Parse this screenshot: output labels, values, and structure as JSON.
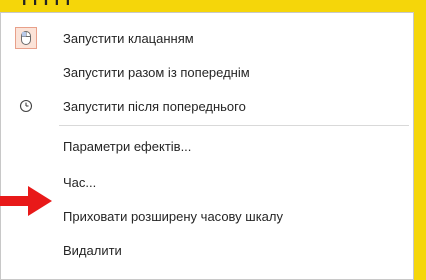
{
  "header": {
    "partial_text": "І і І і і"
  },
  "menu": {
    "items": [
      {
        "label": "Запустити клацанням",
        "icon": "mouse-click-icon"
      },
      {
        "label": "Запустити разом із попереднім",
        "icon": ""
      },
      {
        "label": "Запустити після попереднього",
        "icon": "clock-icon"
      },
      {
        "label": "Параметри ефектів...",
        "icon": ""
      },
      {
        "label": "Час...",
        "icon": ""
      },
      {
        "label": "Приховати розширену часову шкалу",
        "icon": ""
      },
      {
        "label": "Видалити",
        "icon": ""
      }
    ]
  },
  "colors": {
    "background": "#f5d60a",
    "menu_bg": "#ffffff",
    "arrow": "#e81919",
    "icon_highlight": "#fbe3d8"
  },
  "annotation": {
    "arrow_icon": "red-arrow-icon"
  }
}
